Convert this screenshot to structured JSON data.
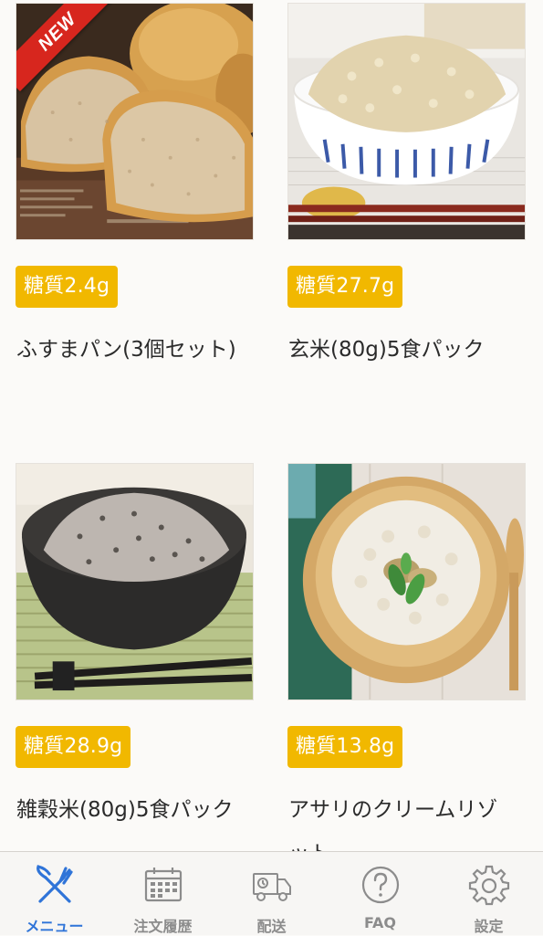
{
  "products": [
    {
      "badge": "糖質2.4g",
      "name": "ふすまパン(3個セット)",
      "is_new": true,
      "new_label": "NEW"
    },
    {
      "badge": "糖質27.7g",
      "name": "玄米(80g)5食パック",
      "is_new": false
    },
    {
      "badge": "糖質28.9g",
      "name": "雑穀米(80g)5食パック",
      "is_new": false
    },
    {
      "badge": "糖質13.8g",
      "name": "アサリのクリームリゾット",
      "is_new": false
    }
  ],
  "tabbar": {
    "items": [
      {
        "label": "メニュー",
        "icon": "fork-knife-icon",
        "active": true
      },
      {
        "label": "注文履歴",
        "icon": "calendar-icon",
        "active": false
      },
      {
        "label": "配送",
        "icon": "delivery-truck-icon",
        "active": false
      },
      {
        "label": "FAQ",
        "icon": "question-circle-icon",
        "active": false
      },
      {
        "label": "設定",
        "icon": "gear-icon",
        "active": false
      }
    ]
  },
  "colors": {
    "badge_bg": "#f1b800",
    "active_tab": "#2f74d8",
    "inactive_tab": "#8c8c8c",
    "new_ribbon": "#d7261e"
  }
}
